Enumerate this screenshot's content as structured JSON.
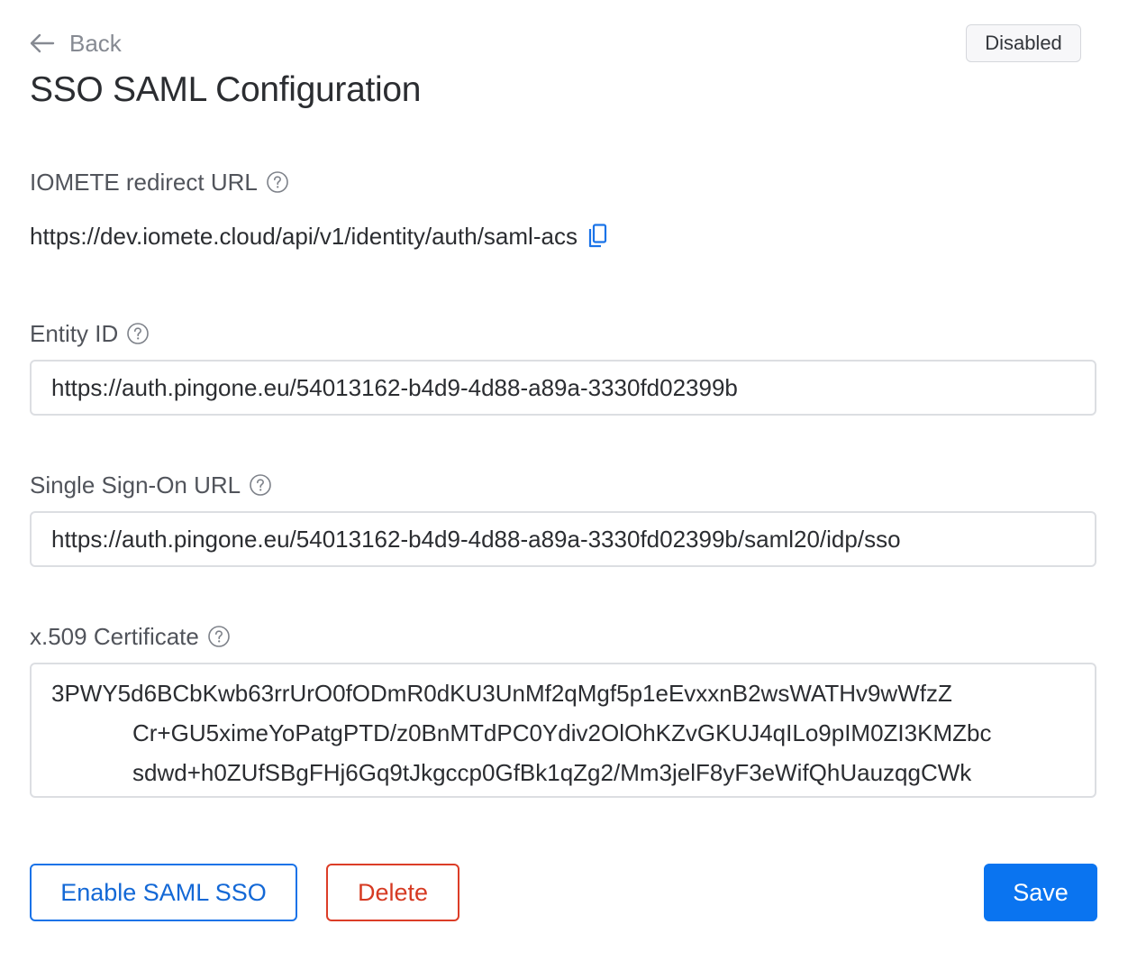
{
  "header": {
    "back_label": "Back",
    "title": "SSO SAML Configuration",
    "status": "Disabled"
  },
  "redirect": {
    "label": "IOMETE redirect URL",
    "url": "https://dev.iomete.cloud/api/v1/identity/auth/saml-acs"
  },
  "entity_id": {
    "label": "Entity ID",
    "value": "https://auth.pingone.eu/54013162-b4d9-4d88-a89a-3330fd02399b"
  },
  "sso_url": {
    "label": "Single Sign-On URL",
    "value": "https://auth.pingone.eu/54013162-b4d9-4d88-a89a-3330fd02399b/saml20/idp/sso"
  },
  "certificate": {
    "label": "x.509 Certificate",
    "lines": [
      "3PWY5d6BCbKwb63rrUrO0fODmR0dKU3UnMf2qMgf5p1eEvxxnB2wsWATHv9wWfzZ",
      "Cr+GU5ximeYoPatgPTD/z0BnMTdPC0Ydiv2OlOhKZvGKUJ4qILo9pIM0ZI3KMZbc",
      "sdwd+h0ZUfSBgFHj6Gq9tJkgccp0GfBk1qZg2/Mm3jelF8yF3eWifQhUauzqgCWk"
    ]
  },
  "actions": {
    "enable_label": "Enable SAML SSO",
    "delete_label": "Delete",
    "save_label": "Save"
  },
  "colors": {
    "primary": "#0a74f0",
    "danger": "#d63a22",
    "muted": "#868a92"
  }
}
